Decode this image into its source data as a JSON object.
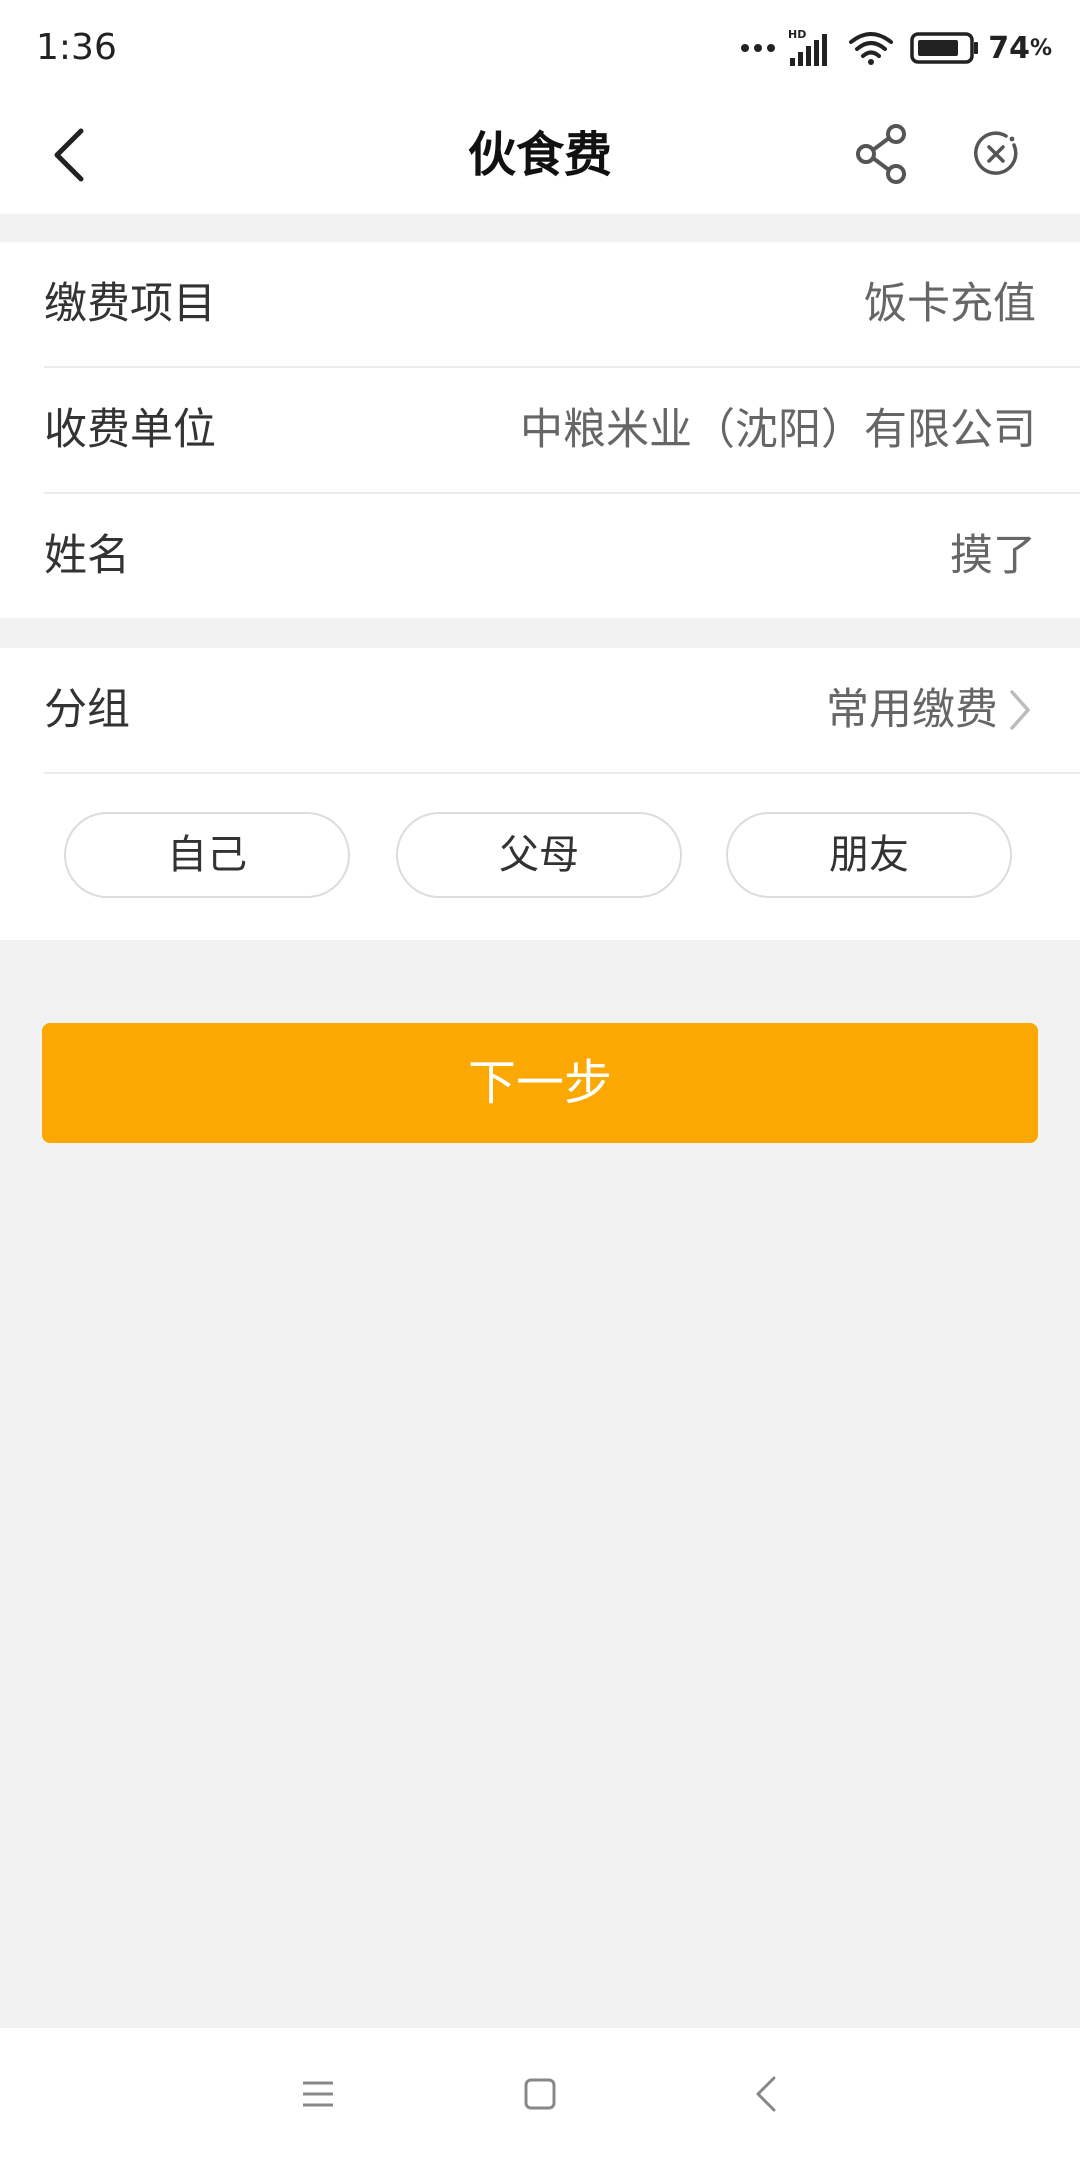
{
  "status_bar": {
    "time": "1:36",
    "network_label": "HD",
    "battery_percent": "74",
    "battery_unit": "%"
  },
  "nav": {
    "title": "伙食费"
  },
  "info": {
    "rows": [
      {
        "label": "缴费项目",
        "value": "饭卡充值"
      },
      {
        "label": "收费单位",
        "value": "中粮米业（沈阳）有限公司"
      },
      {
        "label": "姓名",
        "value": "摸了"
      }
    ]
  },
  "group": {
    "label": "分组",
    "value": "常用缴费",
    "chips": [
      "自己",
      "父母",
      "朋友"
    ]
  },
  "next_button": {
    "label": "下一步"
  },
  "colors": {
    "accent": "#fca803",
    "background": "#f2f2f2",
    "card": "#ffffff"
  },
  "icons": {
    "back": "back-arrow-icon",
    "share": "share-icon",
    "close": "close-circle-icon",
    "chevron": "chevron-right-icon",
    "sys_menu": "menu-icon",
    "sys_home": "home-square-icon",
    "sys_back": "back-triangle-icon"
  }
}
